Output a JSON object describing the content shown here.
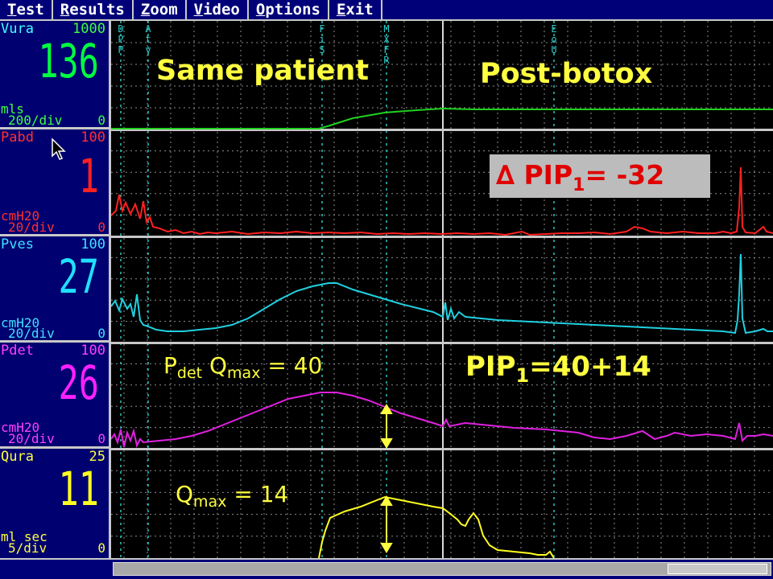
{
  "menu": {
    "items": [
      {
        "first": "T",
        "rest": "est"
      },
      {
        "first": "R",
        "rest": "esults"
      },
      {
        "first": "Z",
        "rest": "oom"
      },
      {
        "first": "V",
        "rest": "ideo"
      },
      {
        "first": "O",
        "rest": "ptions"
      },
      {
        "first": "E",
        "rest": "xit"
      }
    ]
  },
  "channels": {
    "vura": {
      "name": "Vura",
      "max": "1000",
      "value": "136",
      "unit": "mls",
      "div": "200/div",
      "min": "0",
      "color": "#00ff40"
    },
    "pabd": {
      "name": "Pabd",
      "max": "100",
      "value": "1",
      "unit": "cmH20",
      "div": "20/div",
      "min": "0",
      "color": "#ff2020"
    },
    "pves": {
      "name": "Pves",
      "max": "100",
      "value": "27",
      "unit": "cmH20",
      "div": "20/div",
      "min": "0",
      "color": "#20e0ff"
    },
    "pdet": {
      "name": "Pdet",
      "max": "100",
      "value": "26",
      "unit": "cmH20",
      "div": "20/div",
      "min": "0",
      "color": "#ff20ff"
    },
    "qura": {
      "name": "Qura",
      "max": "25",
      "value": "11",
      "unit": "ml sec",
      "div": "5/div",
      "min": "0",
      "color": "#ffff20"
    }
  },
  "event_markers": {
    "dpp": "DPP",
    "atv": "Atv",
    "fis": "FiS",
    "mxfr": "MXFR",
    "eou": "EoU"
  },
  "annotations": {
    "same_patient": "Same patient",
    "post_botox": "Post-botox",
    "delta_symbol": "∆",
    "delta_label": "PIP",
    "delta_sub": "1",
    "delta_value": "= -32",
    "pdet_p": "P",
    "pdet_sub": "det",
    "pdet_q": " Q",
    "pdet_qsub": "max",
    "pdet_value": " = 40",
    "pip_label": "PIP",
    "pip_sub": "1",
    "pip_value": "=40+14",
    "qmax_q": "Q",
    "qmax_sub": "max",
    "qmax_value": " = 14"
  },
  "colors": {
    "menubar": "#000078",
    "sidebar": "#000070",
    "annotation": "#ffff40",
    "delta_box": "#bcbcbc",
    "delta_text": "#e00000",
    "grid": "#8c8c8c"
  }
}
